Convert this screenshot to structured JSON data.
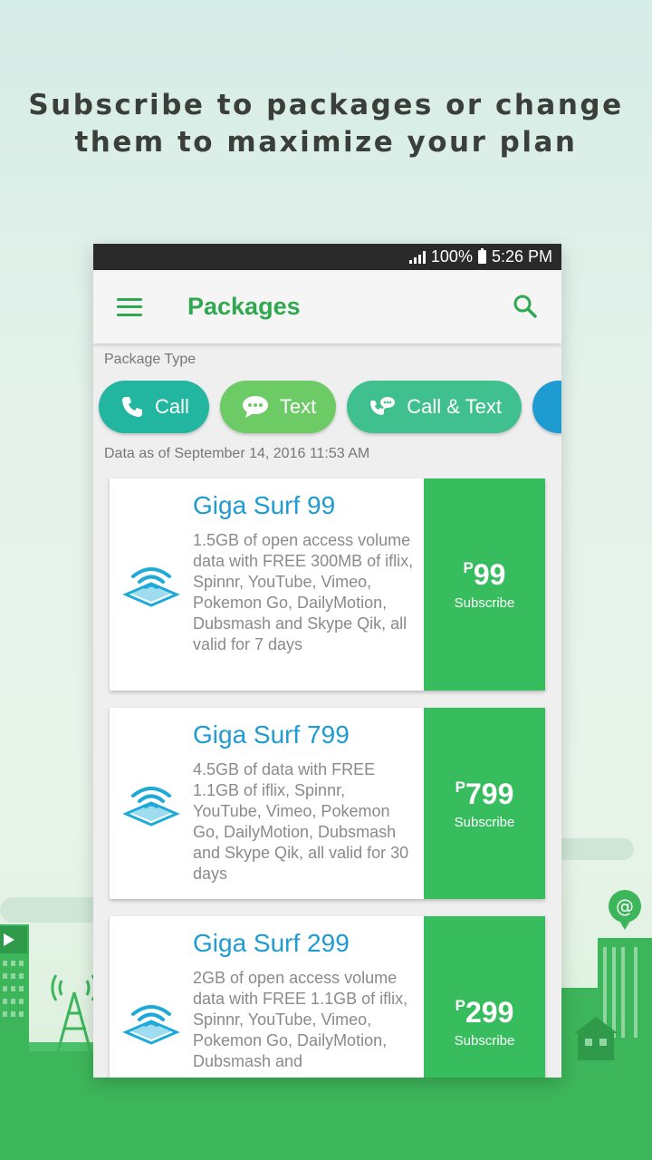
{
  "headline": {
    "line1": "Subscribe to packages or change",
    "line2": "them to maximize your plan"
  },
  "status_bar": {
    "battery": "100%",
    "time": "5:26 PM"
  },
  "app_bar": {
    "title": "Packages",
    "menu_icon": "hamburger-menu-icon",
    "search_icon": "search-icon"
  },
  "filter": {
    "label": "Package Type",
    "chips": [
      {
        "label": "Call",
        "icon": "phone-icon",
        "color": "#22b5a0"
      },
      {
        "label": "Text",
        "icon": "chat-bubble-icon",
        "color": "#6dcb66"
      },
      {
        "label": "Call & Text",
        "icon": "phone-chat-icon",
        "color": "#3fc08e"
      },
      {
        "label": "",
        "icon": "data-icon",
        "color": "#1e9bd0"
      }
    ]
  },
  "as_of": "Data as of September 14, 2016 11:53 AM",
  "packages": [
    {
      "name": "Giga Surf 99",
      "description": "1.5GB of open access volume data with FREE 300MB of iflix, Spinnr, YouTube, Vimeo, Pokemon Go, DailyMotion, Dubsmash and Skype Qik, all valid for 7 days",
      "currency": "P",
      "price": "99",
      "action": "Subscribe",
      "icon": "wifi-data-icon"
    },
    {
      "name": "Giga Surf 799",
      "description": "4.5GB of data with FREE 1.1GB of iflix, Spinnr, YouTube, Vimeo, Pokemon Go, DailyMotion, Dubsmash and Skype Qik, all valid for 30 days",
      "currency": "P",
      "price": "799",
      "action": "Subscribe",
      "icon": "wifi-data-icon"
    },
    {
      "name": "Giga Surf 299",
      "description": "2GB of open access volume data with FREE 1.1GB of iflix, Spinnr, YouTube, Vimeo, Pokemon Go, DailyMotion, Dubsmash and",
      "currency": "P",
      "price": "299",
      "action": "Subscribe",
      "icon": "wifi-data-icon"
    }
  ],
  "colors": {
    "brand_green": "#2fa84f",
    "subscribe_green": "#37bd5e",
    "title_blue": "#1e9bd0"
  }
}
